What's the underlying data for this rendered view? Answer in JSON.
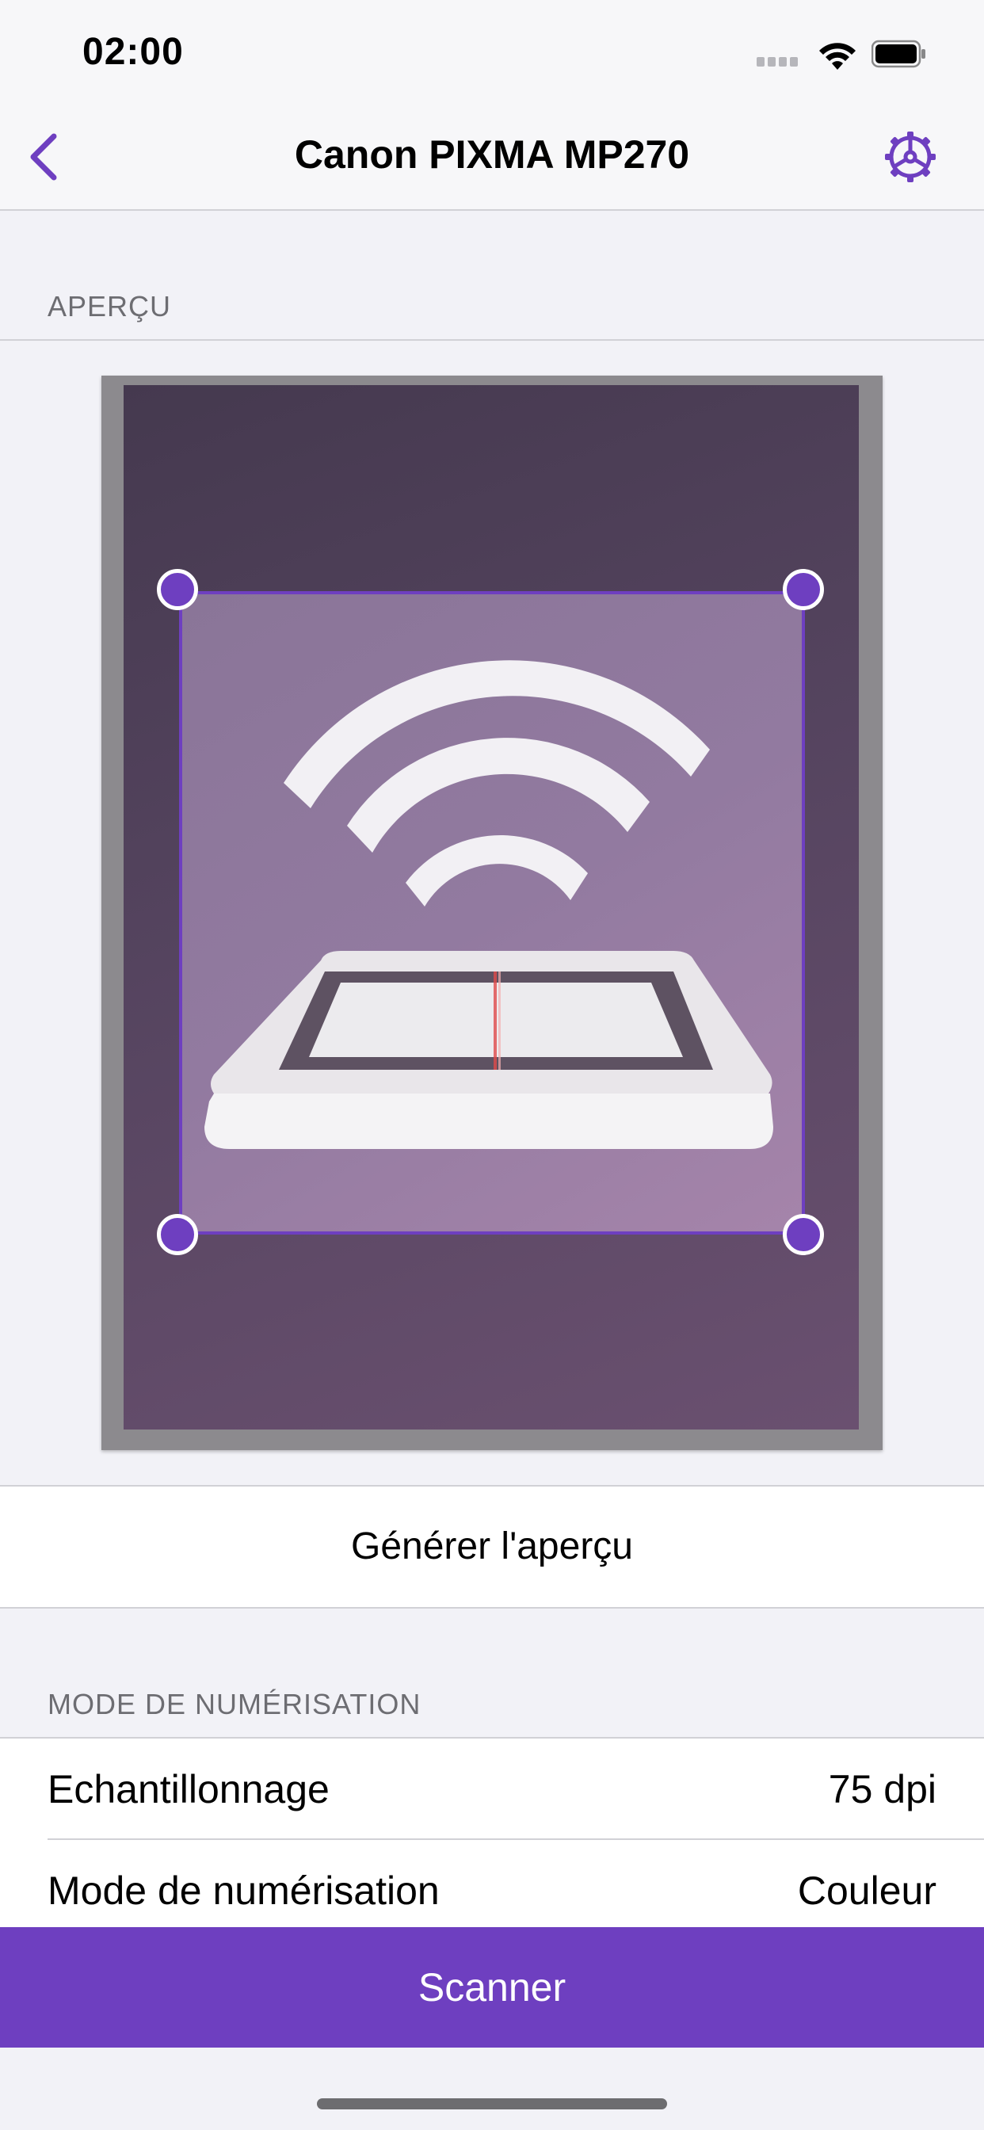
{
  "status_bar": {
    "time": "02:00",
    "icons": [
      "cellular-signal-icon",
      "wifi-icon",
      "battery-icon"
    ]
  },
  "nav": {
    "title": "Canon PIXMA MP270",
    "back_icon": "chevron-left-icon",
    "settings_icon": "gear-icon"
  },
  "colors": {
    "accent": "#6e3fc0",
    "background": "#f2f2f7"
  },
  "preview_section": {
    "label": "APERÇU"
  },
  "preview_button": {
    "label": "Générer l'aperçu"
  },
  "scan_mode_section": {
    "label": "MODE DE NUMÉRISATION"
  },
  "settings": [
    {
      "key": "Echantillonnage",
      "value": "75 dpi"
    },
    {
      "key": "Mode de numérisation",
      "value": "Couleur"
    }
  ],
  "scan_button": {
    "label": "Scanner"
  }
}
